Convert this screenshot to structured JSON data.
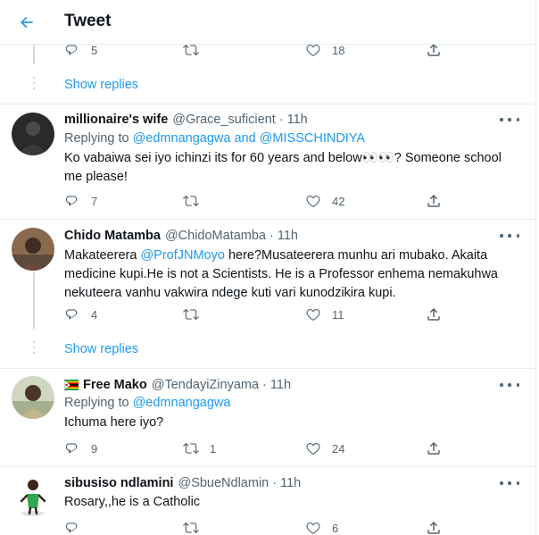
{
  "header": {
    "title": "Tweet"
  },
  "top_actions": {
    "replies": "5",
    "retweets": "",
    "likes": "18"
  },
  "show_replies_label": "Show replies",
  "tweets": [
    {
      "name": "millionaire's wife",
      "handle": "@Grace_suficient",
      "time": "11h",
      "replying_prefix": "Replying to",
      "mention1": "@edmnangagwa",
      "and_word": "and",
      "mention2": "@MISSCHINDIYA",
      "text": "Ko vabaiwa sei iyo ichinzi its for 60 years and below👀👀? Someone school me please!",
      "replies": "7",
      "retweets": "",
      "likes": "42"
    },
    {
      "name": "Chido Matamba",
      "handle": "@ChidoMatamba",
      "time": "11h",
      "text_pre": "Makateerera",
      "mention1": "@ProfJNMoyo",
      "text_post": "here?Musateerera munhu ari mubako. Akaita medicine kupi.He is not a Scientists. He is a Professor enhema nemakuhwa nekuteera vanhu vakwira ndege kuti vari kunodzikira kupi.",
      "replies": "4",
      "retweets": "",
      "likes": "11"
    },
    {
      "name": "Free Mako",
      "handle": "@TendayiZinyama",
      "time": "11h",
      "replying_prefix": "Replying to",
      "mention1": "@edmnangagwa",
      "text": "Ichuma here iyo?",
      "replies": "9",
      "retweets": "1",
      "likes": "24"
    },
    {
      "name": "sibusiso ndlamini",
      "handle": "@SbueNdlamin",
      "time": "11h",
      "text": "Rosary,,he is a Catholic",
      "replies": "",
      "retweets": "",
      "likes": "6"
    }
  ],
  "colors": {
    "accent": "#1d9bf0",
    "muted": "#536471",
    "border": "#e6ecf0"
  },
  "icons": [
    "back-arrow-icon",
    "reply-icon",
    "retweet-icon",
    "like-icon",
    "share-icon",
    "more-icon",
    "zimbabwe-flag-icon"
  ]
}
